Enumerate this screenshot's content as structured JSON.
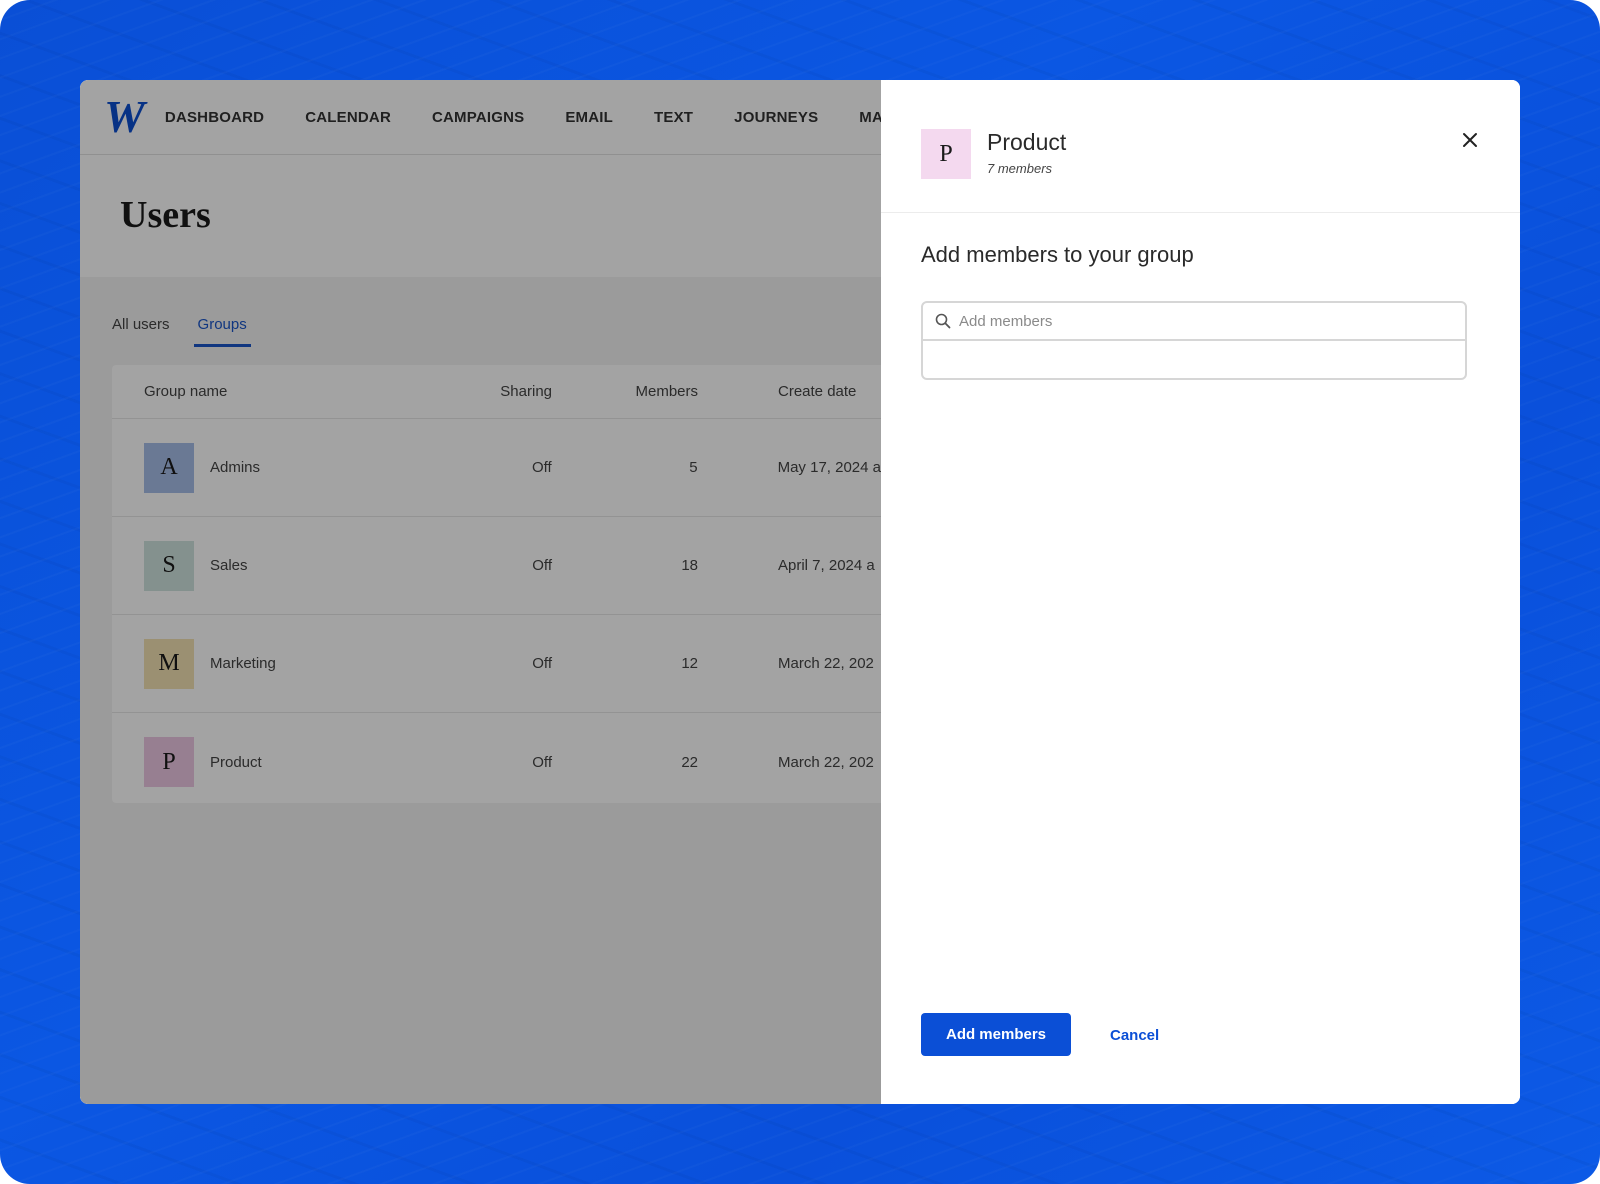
{
  "nav": {
    "logo": "W",
    "items": [
      "DASHBOARD",
      "CALENDAR",
      "CAMPAIGNS",
      "EMAIL",
      "TEXT",
      "JOURNEYS",
      "MA"
    ]
  },
  "page": {
    "title": "Users"
  },
  "tabs": [
    {
      "label": "All users",
      "active": false
    },
    {
      "label": "Groups",
      "active": true
    }
  ],
  "table": {
    "headers": {
      "name": "Group name",
      "sharing": "Sharing",
      "members": "Members",
      "date": "Create date"
    },
    "rows": [
      {
        "initial": "A",
        "name": "Admins",
        "sharing": "Off",
        "members": "5",
        "date": "May 17, 2024 a",
        "color": "#a7bde8"
      },
      {
        "initial": "S",
        "name": "Sales",
        "sharing": "Off",
        "members": "18",
        "date": "April 7, 2024 a",
        "color": "#cfe3de"
      },
      {
        "initial": "M",
        "name": "Marketing",
        "sharing": "Off",
        "members": "12",
        "date": "March 22, 202",
        "color": "#f3e2b3"
      },
      {
        "initial": "P",
        "name": "Product",
        "sharing": "Off",
        "members": "22",
        "date": "March 22, 202",
        "color": "#ecc7e3"
      }
    ]
  },
  "panel": {
    "avatar_initial": "P",
    "title": "Product",
    "subtitle": "7 members",
    "section_title": "Add members to your group",
    "search_placeholder": "Add members",
    "primary_button": "Add members",
    "cancel_button": "Cancel"
  },
  "colors": {
    "accent": "#0b4fd6",
    "panel_avatar": "#f4d9ef"
  }
}
